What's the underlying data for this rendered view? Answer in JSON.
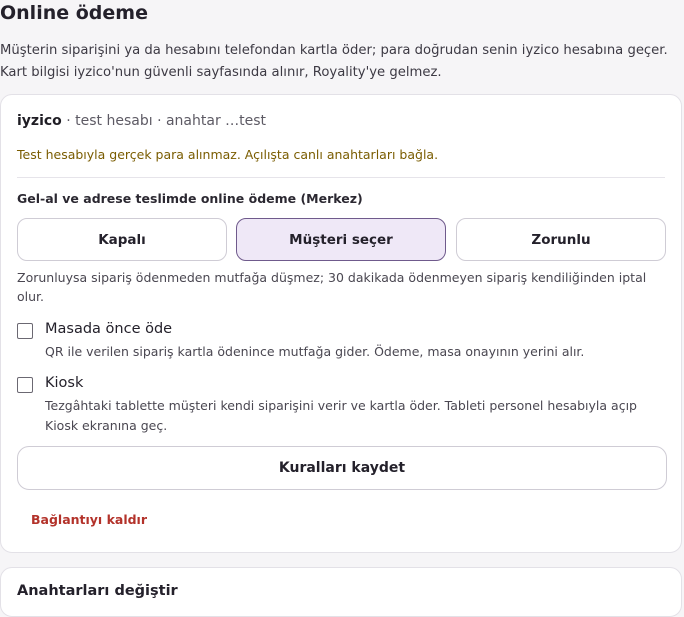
{
  "header": {
    "title": "Online ödeme",
    "description_line1": "Müşterin siparişini ya da hesabını telefondan kartla öder; para doğrudan senin iyzico hesabına geçer.",
    "description_line2": "Kart bilgisi iyzico'nun güvenli sayfasında alınır, Royality'ye gelmez."
  },
  "provider": {
    "name": "iyzico",
    "details": " · test hesabı · anahtar …test",
    "warning": "Test hesabıyla gerçek para alınmaz. Açılışta canlı anahtarları bağla."
  },
  "delivery_mode": {
    "label": "Gel-al ve adrese teslimde online ödeme (Merkez)",
    "options": [
      "Kapalı",
      "Müşteri seçer",
      "Zorunlu"
    ],
    "selected": "Müşteri seçer",
    "help": "Zorunluysa sipariş ödenmeden mutfağa düşmez; 30 dakikada ödenmeyen sipariş kendiliğinden iptal olur."
  },
  "options": [
    {
      "title": "Masada önce öde",
      "description": "QR ile verilen sipariş kartla ödenince mutfağa gider. Ödeme, masa onayının yerini alır.",
      "checked": false
    },
    {
      "title": "Kiosk",
      "description": "Tezgâhtaki tablette müşteri kendi siparişini verir ve kartla öder. Tableti personel hesabıyla açıp Kiosk ekranına geç.",
      "checked": false
    }
  ],
  "actions": {
    "save_label": "Kuralları kaydet",
    "disconnect_label": "Bağlantıyı kaldır"
  },
  "keys_section": {
    "title": "Anahtarları değiştir"
  },
  "colors": {
    "selected_background": "#efe8f7",
    "selected_border": "#6f5a8c",
    "warning_text": "#7a5c00",
    "danger_text": "#b3322a"
  }
}
